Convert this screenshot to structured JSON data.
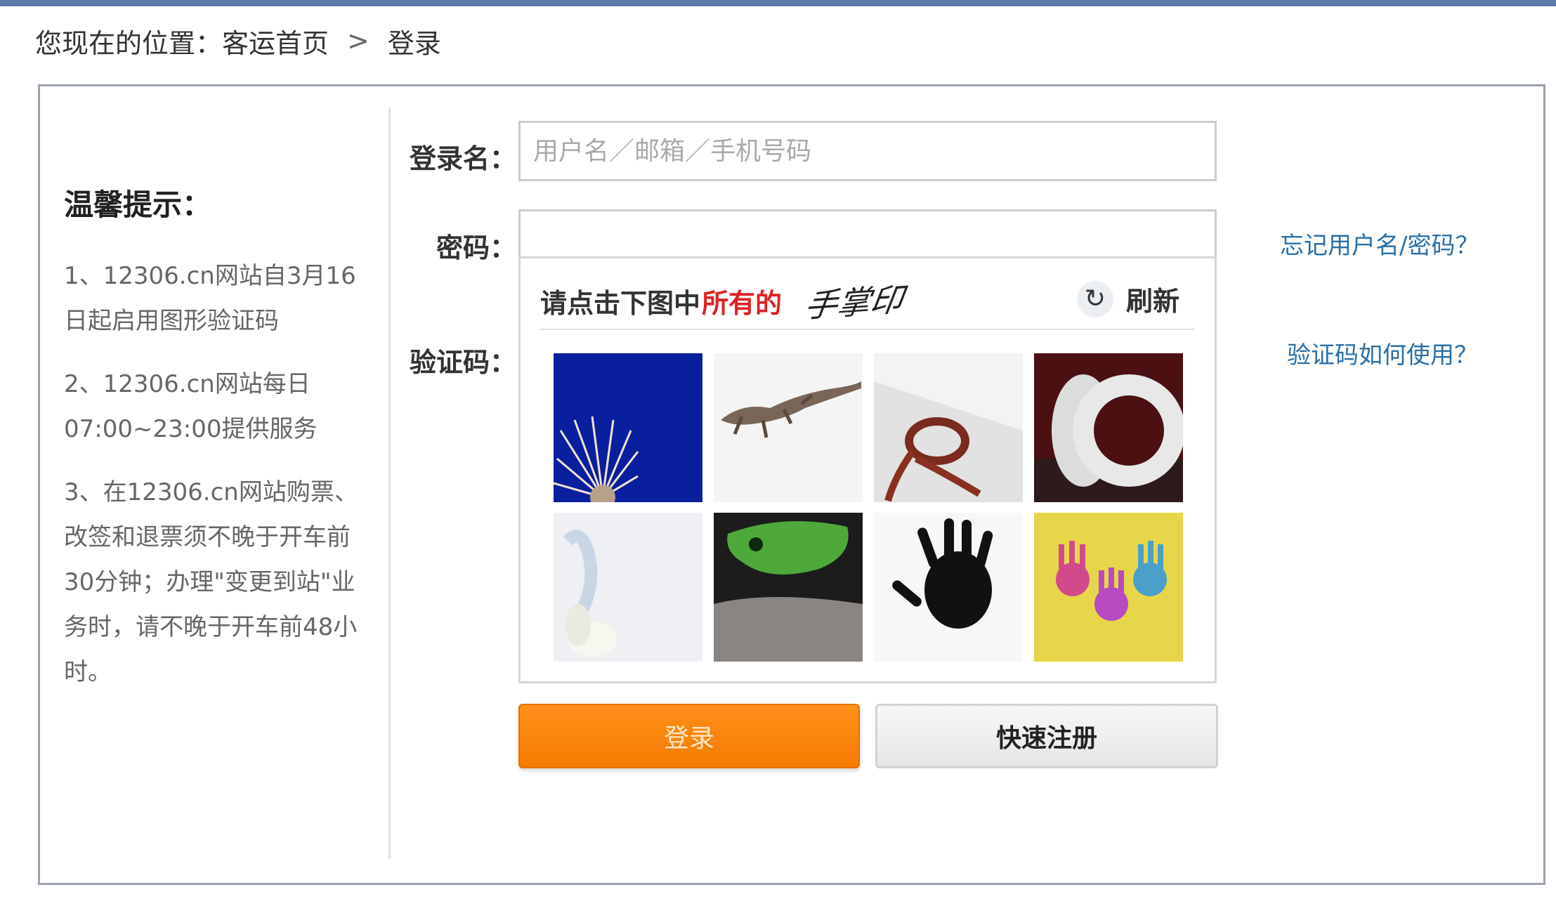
{
  "breadcrumb": {
    "prefix": "您现在的位置：",
    "home": "客运首页",
    "separator": ">",
    "current": "登录"
  },
  "tips": {
    "title": "温馨提示：",
    "items": [
      "1、12306.cn网站自3月16日起启用图形验证码",
      "2、12306.cn网站每日07:00~23:00提供服务",
      "3、在12306.cn网站购票、改签和退票须不晚于开车前30分钟；办理\"变更到站\"业务时，请不晚于开车前48小时。"
    ]
  },
  "form": {
    "username_label": "登录名：",
    "username_placeholder": "用户名／邮箱／手机号码",
    "password_label": "密码：",
    "forgot_link": "忘记用户名/密码？",
    "captcha_label": "验证码：",
    "captcha_help_link": "验证码如何使用？"
  },
  "captcha": {
    "prompt": "请点击下图中",
    "highlight": "所有的",
    "target": "手掌印",
    "refresh_label": "刷新",
    "refresh_icon": "refresh-icon",
    "images": [
      "dandelion-seed-icon",
      "lizard-icon",
      "ribbon-icon",
      "tape-roll-icon",
      "white-flower-icon",
      "green-frog-icon",
      "black-handprint-icon",
      "colorful-handprints-icon"
    ]
  },
  "buttons": {
    "login": "登录",
    "register": "快速注册"
  },
  "colors": {
    "accent_orange": "#f57c00",
    "link_blue": "#2a6fa8",
    "highlight_red": "#dd2222"
  }
}
